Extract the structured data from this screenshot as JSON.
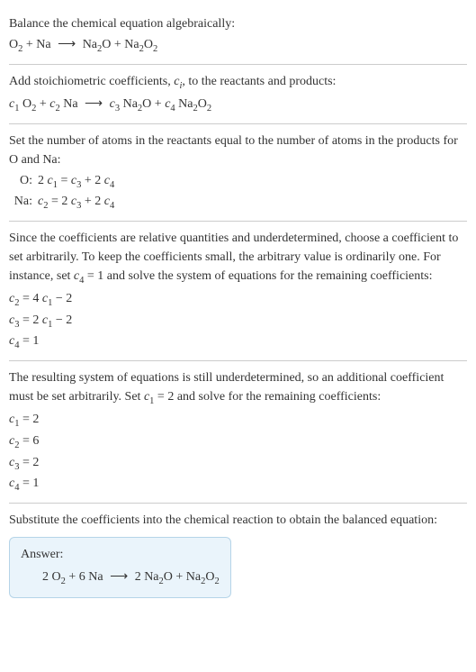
{
  "s1": {
    "title": "Balance the chemical equation algebraically:",
    "eq_pre": "O",
    "eq_o2sub": "2",
    "eq_plus1": " + Na ",
    "arrow": "⟶",
    "eq_na2o_na": " Na",
    "eq_na2o_2": "2",
    "eq_na2o_o": "O + Na",
    "eq_na2o2_2a": "2",
    "eq_na2o2_o": "O",
    "eq_na2o2_2b": "2"
  },
  "s2": {
    "title_a": "Add stoichiometric coefficients, ",
    "title_ci": "c",
    "title_ci_sub": "i",
    "title_b": ", to the reactants and products:",
    "c1": "c",
    "c1s": "1",
    "sp1": " O",
    "o2s": "2",
    "plus1": " + ",
    "c2": "c",
    "c2s": "2",
    "sp2": " Na ",
    "arrow": "⟶",
    "sp3": " ",
    "c3": "c",
    "c3s": "3",
    "sp4": " Na",
    "na2a": "2",
    "sp5": "O + ",
    "c4": "c",
    "c4s": "4",
    "sp6": " Na",
    "na2b": "2",
    "sp7": "O",
    "o2b": "2"
  },
  "s3": {
    "title": "Set the number of atoms in the reactants equal to the number of atoms in the products for O and Na:",
    "o_label": "O:",
    "o_eq_a": "2 ",
    "o_c1": "c",
    "o_c1s": "1",
    "o_eq_b": " = ",
    "o_c3": "c",
    "o_c3s": "3",
    "o_eq_c": " + 2 ",
    "o_c4": "c",
    "o_c4s": "4",
    "na_label": "Na:",
    "na_c2": "c",
    "na_c2s": "2",
    "na_eq_a": " = 2 ",
    "na_c3": "c",
    "na_c3s": "3",
    "na_eq_b": " + 2 ",
    "na_c4": "c",
    "na_c4s": "4"
  },
  "s4": {
    "title_a": "Since the coefficients are relative quantities and underdetermined, choose a coefficient to set arbitrarily. To keep the coefficients small, the arbitrary value is ordinarily one. For instance, set ",
    "c4": "c",
    "c4s": "4",
    "title_b": " = 1 and solve the system of equations for the remaining coefficients:",
    "l1_c": "c",
    "l1_cs": "2",
    "l1_eq": " = 4 ",
    "l1_c1": "c",
    "l1_c1s": "1",
    "l1_end": " − 2",
    "l2_c": "c",
    "l2_cs": "3",
    "l2_eq": " = 2 ",
    "l2_c1": "c",
    "l2_c1s": "1",
    "l2_end": " − 2",
    "l3_c": "c",
    "l3_cs": "4",
    "l3_eq": " = 1"
  },
  "s5": {
    "title_a": "The resulting system of equations is still underdetermined, so an additional coefficient must be set arbitrarily. Set ",
    "c1": "c",
    "c1s": "1",
    "title_b": " = 2 and solve for the remaining coefficients:",
    "l1_c": "c",
    "l1_cs": "1",
    "l1_v": " = 2",
    "l2_c": "c",
    "l2_cs": "2",
    "l2_v": " = 6",
    "l3_c": "c",
    "l3_cs": "3",
    "l3_v": " = 2",
    "l4_c": "c",
    "l4_cs": "4",
    "l4_v": " = 1"
  },
  "s6": {
    "title": "Substitute the coefficients into the chemical reaction to obtain the balanced equation:",
    "answer_label": "Answer:",
    "a1": "2 O",
    "a1s": "2",
    "a2": " + 6 Na ",
    "arrow": "⟶",
    "a3": " 2 Na",
    "a3s": "2",
    "a4": "O + Na",
    "a4s": "2",
    "a5": "O",
    "a5s": "2"
  }
}
